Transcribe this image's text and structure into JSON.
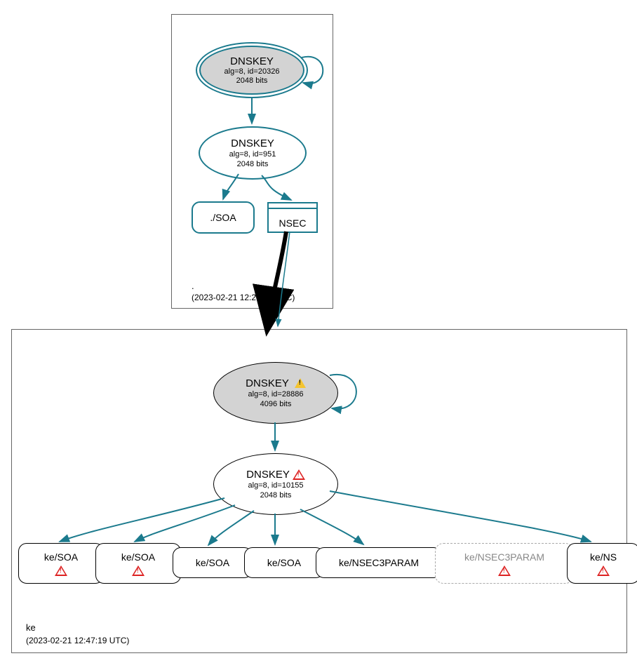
{
  "zones": {
    "root": {
      "name": ".",
      "timestamp": "(2023-02-21 12:26:18 UTC)",
      "dnskey_ksk": {
        "title": "DNSKEY",
        "line1": "alg=8, id=20326",
        "line2": "2048 bits"
      },
      "dnskey_zsk": {
        "title": "DNSKEY",
        "line1": "alg=8, id=951",
        "line2": "2048 bits"
      },
      "soa": "./SOA",
      "nsec": "NSEC"
    },
    "ke": {
      "name": "ke",
      "timestamp": "(2023-02-21 12:47:19 UTC)",
      "dnskey_ksk": {
        "title": "DNSKEY",
        "line1": "alg=8, id=28886",
        "line2": "4096 bits"
      },
      "dnskey_zsk": {
        "title": "DNSKEY",
        "line1": "alg=8, id=10155",
        "line2": "2048 bits"
      },
      "records": {
        "r1": "ke/SOA",
        "r2": "ke/SOA",
        "r3": "ke/SOA",
        "r4": "ke/SOA",
        "r5": "ke/NSEC3PARAM",
        "r6": "ke/NSEC3PARAM",
        "r7": "ke/NS"
      }
    }
  }
}
